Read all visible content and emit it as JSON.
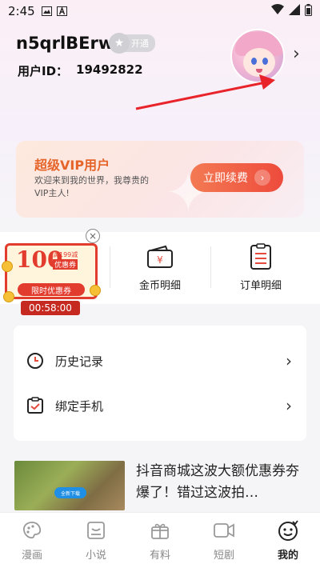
{
  "status_bar": {
    "time": "2:45"
  },
  "profile": {
    "username": "n5qrlBErw",
    "vip_badge_label": "开通",
    "user_id_label": "用户ID：",
    "user_id_value": "19492822"
  },
  "vip_card": {
    "title": "超级VIP用户",
    "description": "欢迎来到我的世界，我尊贵的VIP主人!",
    "renew_label": "立即续费"
  },
  "coupon": {
    "amount": "100",
    "threshold_text": "满199减",
    "badge_text": "优惠券",
    "limited_label": "限时优惠券",
    "countdown": "00:58:00"
  },
  "shortcuts": [
    {
      "label": "金币明细",
      "icon": "wallet-icon"
    },
    {
      "label": "订单明细",
      "icon": "order-list-icon"
    }
  ],
  "menu": [
    {
      "label": "历史记录",
      "icon": "clock-icon"
    },
    {
      "label": "绑定手机",
      "icon": "checklist-icon"
    }
  ],
  "promo": {
    "headline": "抖音商城这波大额优惠券夯爆了！错过这波拍…",
    "thumb_button": "全新下载"
  },
  "tabs": [
    {
      "label": "漫画",
      "icon": "palette-icon",
      "active": false
    },
    {
      "label": "小说",
      "icon": "book-icon",
      "active": false
    },
    {
      "label": "有料",
      "icon": "gift-icon",
      "active": false
    },
    {
      "label": "短剧",
      "icon": "video-icon",
      "active": false
    },
    {
      "label": "我的",
      "icon": "smile-face-icon",
      "active": true
    }
  ],
  "colors": {
    "accent": "#ee4b3c",
    "vip_title": "#e5642a",
    "annotation_arrow": "#e8232a"
  }
}
